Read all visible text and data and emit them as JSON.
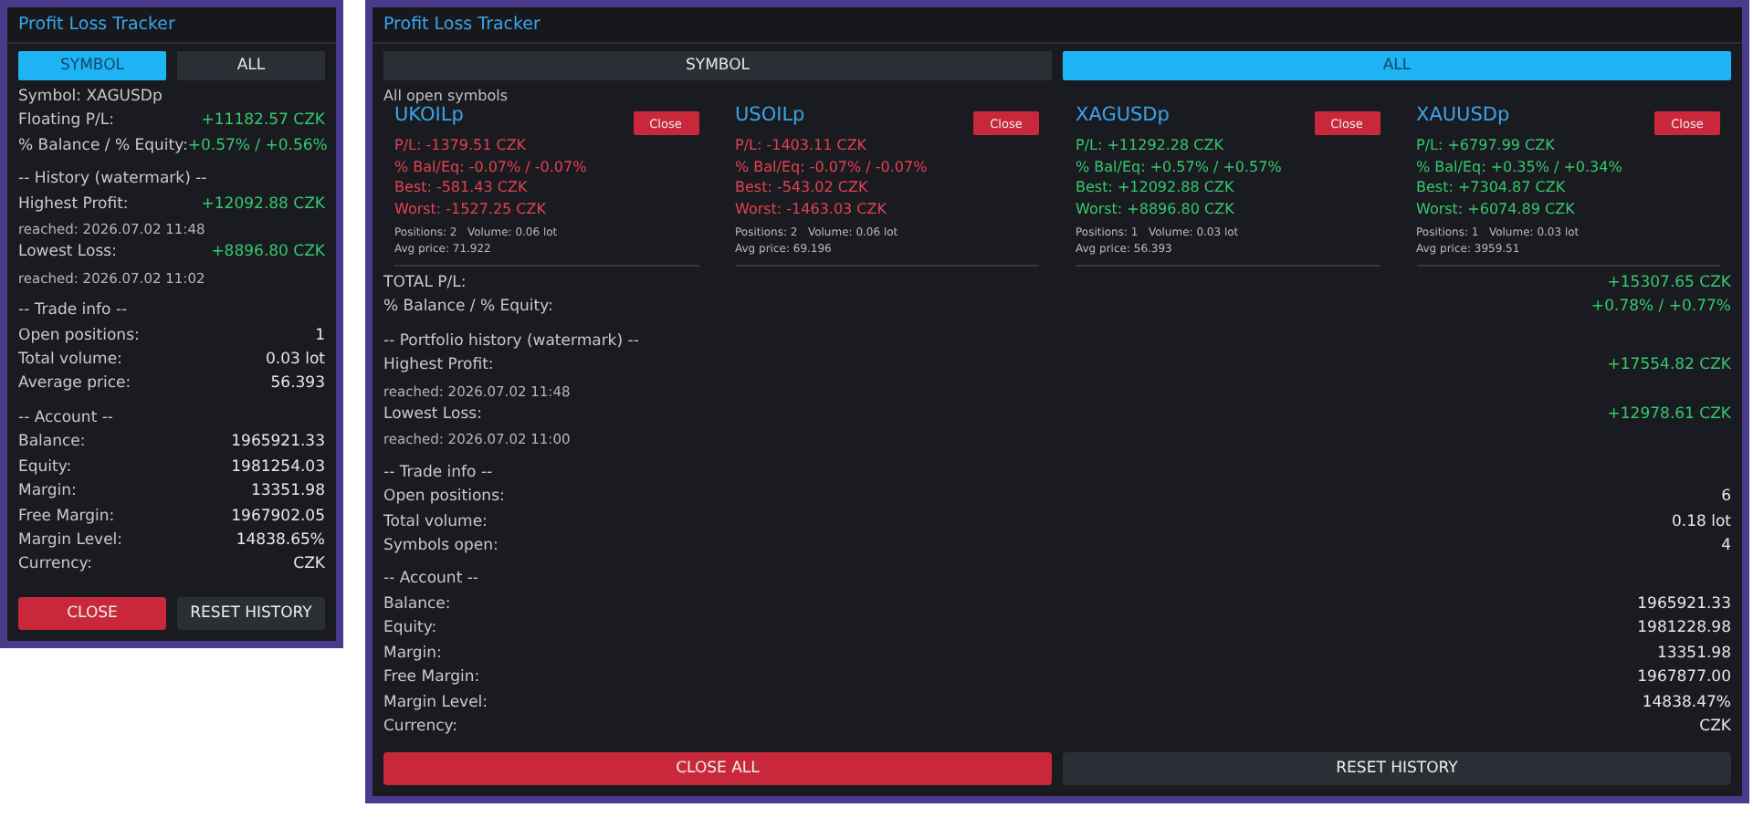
{
  "panels": [
    {
      "title": "Profit Loss Tracker",
      "tabs": [
        {
          "label": "SYMBOL",
          "selected": true
        },
        {
          "label": "ALL",
          "selected": false
        }
      ],
      "rows": [
        {
          "kind": "row",
          "label": "Symbol: XAGUSDp"
        },
        {
          "kind": "row",
          "label": "Floating P/L:",
          "value": "+11182.57 CZK",
          "color": "#35c76e"
        },
        {
          "kind": "row",
          "label": "% Balance / % Equity:",
          "value": "+0.57% / +0.56%",
          "color": "#35c76e"
        },
        {
          "kind": "heading",
          "label": "-- History (watermark) --"
        },
        {
          "kind": "row",
          "label": "Highest Profit:",
          "value": "+12092.88 CZK",
          "color": "#35c76e"
        },
        {
          "kind": "note",
          "label": "reached: 2026.07.02 11:48"
        },
        {
          "kind": "row",
          "label": "Lowest Loss:",
          "value": "+8896.80 CZK",
          "color": "#35c76e"
        },
        {
          "kind": "note",
          "label": "reached: 2026.07.02 11:02"
        },
        {
          "kind": "heading",
          "label": "-- Trade info --"
        },
        {
          "kind": "row",
          "label": "Open positions:",
          "value": "1",
          "color": "#e6e6e6"
        },
        {
          "kind": "row",
          "label": "Total volume:",
          "value": "0.03 lot",
          "color": "#e6e6e6"
        },
        {
          "kind": "row",
          "label": "Average price:",
          "value": "56.393",
          "color": "#e6e6e6"
        },
        {
          "kind": "heading",
          "label": "-- Account --"
        },
        {
          "kind": "row",
          "label": "Balance:",
          "value": "1965921.33",
          "color": "#e6e6e6"
        },
        {
          "kind": "row",
          "label": "Equity:",
          "value": "1981254.03",
          "color": "#e6e6e6"
        },
        {
          "kind": "row",
          "label": "Margin:",
          "value": "13351.98",
          "color": "#e6e6e6"
        },
        {
          "kind": "row",
          "label": "Free Margin:",
          "value": "1967902.05",
          "color": "#e6e6e6"
        },
        {
          "kind": "row",
          "label": "Margin Level:",
          "value": "14838.65%",
          "color": "#e6e6e6"
        },
        {
          "kind": "row",
          "label": "Currency:",
          "value": "CZK",
          "color": "#e6e6e6"
        }
      ],
      "buttons": [
        {
          "label": "CLOSE",
          "kind": "danger"
        },
        {
          "label": "RESET HISTORY",
          "kind": "plain"
        }
      ]
    },
    {
      "title": "Profit Loss Tracker",
      "tabs": [
        {
          "label": "SYMBOL",
          "selected": false
        },
        {
          "label": "ALL",
          "selected": true
        }
      ],
      "caption": "All open symbols",
      "cards": [
        {
          "symbol": "UKOILp",
          "color": "#e0434f",
          "button": "Close",
          "lines": [
            "P/L: -1379.51 CZK",
            "% Bal/Eq: -0.07% / -0.07%",
            "Best: -581.43 CZK",
            "Worst: -1527.25 CZK"
          ],
          "details": [
            "Positions: 2   Volume: 0.06 lot",
            "Avg price: 71.922"
          ]
        },
        {
          "symbol": "USOILp",
          "color": "#e0434f",
          "button": "Close",
          "lines": [
            "P/L: -1403.11 CZK",
            "% Bal/Eq: -0.07% / -0.07%",
            "Best: -543.02 CZK",
            "Worst: -1463.03 CZK"
          ],
          "details": [
            "Positions: 2   Volume: 0.06 lot",
            "Avg price: 69.196"
          ]
        },
        {
          "symbol": "XAGUSDp",
          "color": "#35c76e",
          "button": "Close",
          "lines": [
            "P/L: +11292.28 CZK",
            "% Bal/Eq: +0.57% / +0.57%",
            "Best: +12092.88 CZK",
            "Worst: +8896.80 CZK"
          ],
          "details": [
            "Positions: 1   Volume: 0.03 lot",
            "Avg price: 56.393"
          ]
        },
        {
          "symbol": "XAUUSDp",
          "color": "#35c76e",
          "button": "Close",
          "lines": [
            "P/L: +6797.99 CZK",
            "% Bal/Eq: +0.35% / +0.34%",
            "Best: +7304.87 CZK",
            "Worst: +6074.89 CZK"
          ],
          "details": [
            "Positions: 1   Volume: 0.03 lot",
            "Avg price: 3959.51"
          ]
        }
      ],
      "rows": [
        {
          "kind": "row",
          "label": "TOTAL P/L:",
          "value": "+15307.65 CZK",
          "color": "#35c76e"
        },
        {
          "kind": "row",
          "label": "% Balance / % Equity:",
          "value": "+0.78% / +0.77%",
          "color": "#35c76e"
        },
        {
          "kind": "heading",
          "label": "-- Portfolio history (watermark) --"
        },
        {
          "kind": "row",
          "label": "Highest Profit:",
          "value": "+17554.82 CZK",
          "color": "#35c76e"
        },
        {
          "kind": "note",
          "label": "reached: 2026.07.02 11:48"
        },
        {
          "kind": "row",
          "label": "Lowest Loss:",
          "value": "+12978.61 CZK",
          "color": "#35c76e"
        },
        {
          "kind": "note",
          "label": "reached: 2026.07.02 11:00"
        },
        {
          "kind": "heading",
          "label": "-- Trade info --"
        },
        {
          "kind": "row",
          "label": "Open positions:",
          "value": "6",
          "color": "#e6e6e6"
        },
        {
          "kind": "row",
          "label": "Total volume:",
          "value": "0.18 lot",
          "color": "#e6e6e6"
        },
        {
          "kind": "row",
          "label": "Symbols open:",
          "value": "4",
          "color": "#e6e6e6"
        },
        {
          "kind": "heading",
          "label": "-- Account --"
        },
        {
          "kind": "row",
          "label": "Balance:",
          "value": "1965921.33",
          "color": "#e6e6e6"
        },
        {
          "kind": "row",
          "label": "Equity:",
          "value": "1981228.98",
          "color": "#e6e6e6"
        },
        {
          "kind": "row",
          "label": "Margin:",
          "value": "13351.98",
          "color": "#e6e6e6"
        },
        {
          "kind": "row",
          "label": "Free Margin:",
          "value": "1967877.00",
          "color": "#e6e6e6"
        },
        {
          "kind": "row",
          "label": "Margin Level:",
          "value": "14838.47%",
          "color": "#e6e6e6"
        },
        {
          "kind": "row",
          "label": "Currency:",
          "value": "CZK",
          "color": "#e6e6e6"
        }
      ],
      "buttons": [
        {
          "label": "CLOSE ALL",
          "kind": "danger"
        },
        {
          "label": "RESET HISTORY",
          "kind": "plain"
        }
      ]
    }
  ]
}
